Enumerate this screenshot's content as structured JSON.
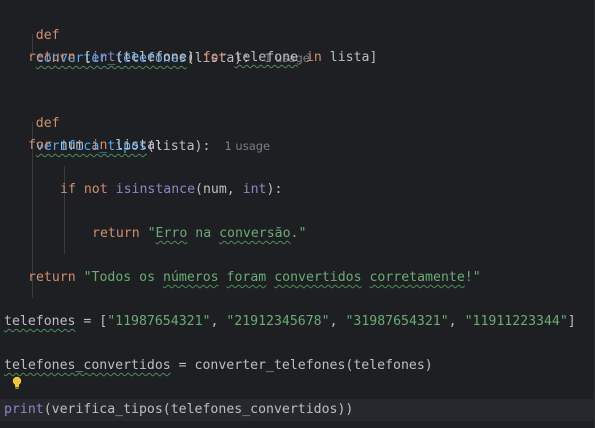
{
  "editor": {
    "lines": [
      {
        "kw": "def",
        "fn": "converter_telefones",
        "rest": "(lista):",
        "hint": "1 usage"
      },
      {
        "kw1": "return",
        "p1": " [",
        "bi1": "int",
        "p2": "(telefone) ",
        "kw2": "for",
        "p3": " ",
        "sq1": "telefone",
        "p4": " ",
        "kw3": "in",
        "p5": " lista]"
      },
      {
        "kw": "def",
        "fn": "verifica_tipos",
        "rest": "(lista):",
        "hint": "1 usage"
      },
      {
        "kw1": "for",
        "p1": " num ",
        "kw2": "in",
        "p2": " lista:"
      },
      {
        "kw1": "if",
        "p1": " ",
        "kw2": "not",
        "p2": " ",
        "bi1": "isinstance",
        "p3": "(num, ",
        "bi2": "int",
        "p4": "):"
      },
      {
        "kw1": "return",
        "p1": " ",
        "str1": "\"",
        "sq1": "Erro",
        "str2": " na ",
        "sq2": "conversão",
        "str3": ".\""
      },
      {
        "kw1": "return",
        "p1": " ",
        "str1": "\"Todos os ",
        "sq1": "números",
        "str2": " ",
        "sq2": "foram",
        "str3": " ",
        "sq3": "convertidos",
        "str4": " ",
        "sq4": "corretamente",
        "str5": "!\""
      },
      {
        "sq1": "telefones",
        "p1": " = [",
        "s1": "\"11987654321\"",
        "p2": ", ",
        "s2": "\"21912345678\"",
        "p3": ", ",
        "s3": "\"31987654321\"",
        "p4": ", ",
        "s4": "\"11911223344\"",
        "p5": "]"
      },
      {
        "sq1": "telefones_convertidos",
        "p1": " = converter_telefones(telefones)"
      },
      {
        "bi1": "print",
        "p1": "(verifica_tipos(telefones_convertidos))"
      }
    ]
  },
  "colors": {
    "background": "#1e1f22",
    "keyword": "#cf8e6d",
    "function": "#56a8f5",
    "builtin": "#8888c6",
    "string": "#6aab73",
    "text": "#bcbec4",
    "hint": "#7a7e85"
  },
  "icons": {
    "intention_bulb": "lightbulb-icon"
  }
}
